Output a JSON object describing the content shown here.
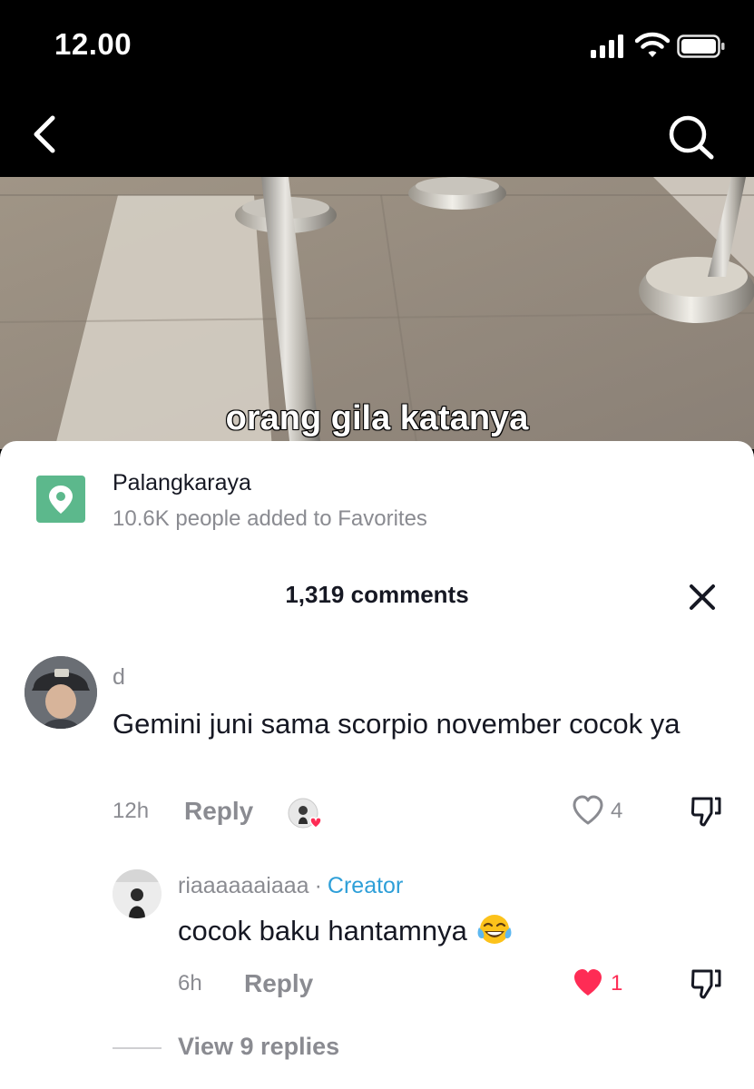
{
  "status_bar": {
    "time": "12.00",
    "icons": [
      "cellular-signal-icon",
      "wifi-icon",
      "battery-icon"
    ]
  },
  "nav": {
    "back_icon": "chevron-left-icon",
    "search_icon": "search-icon"
  },
  "video": {
    "caption": "orang gila katanya"
  },
  "location": {
    "icon": "location-pin-icon",
    "name": "Palangkaraya",
    "favorites": "10.6K people added to Favorites"
  },
  "comments_header": {
    "count_label": "1,319 comments",
    "close_icon": "close-icon"
  },
  "comment": {
    "author": "d",
    "text": "Gemini juni sama scorpio november cocok ya",
    "time": "12h",
    "reply_label": "Reply",
    "likes": "4"
  },
  "reply": {
    "author": "riaaaaaaiaaa",
    "separator": "·",
    "badge": "Creator",
    "text": "cocok baku hantamnya",
    "emoji": "laughing-tears-emoji",
    "time": "6h",
    "reply_label": "Reply",
    "likes": "1",
    "liked": true
  },
  "view_replies": "View 9 replies",
  "colors": {
    "accent_like": "#fe2c55",
    "creator_blue": "#2e9fd8",
    "location_green": "#5cb88c",
    "secondary_text": "#8a8b91",
    "primary_text": "#161823"
  }
}
